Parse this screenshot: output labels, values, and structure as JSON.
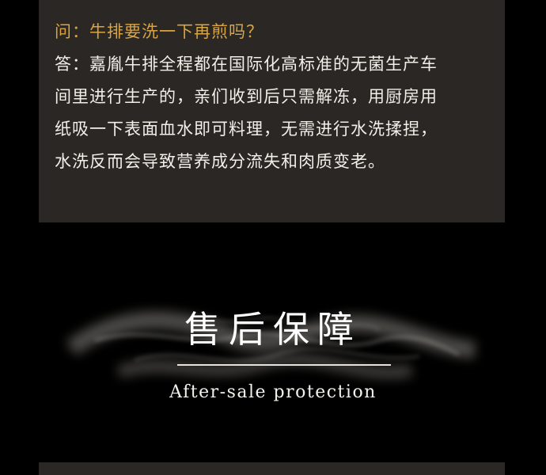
{
  "faq": {
    "question": "问：牛排要洗一下再煎吗？",
    "answer_lines": [
      "答：嘉胤牛排全程都在国际化高标准的无菌生产车",
      "间里进行生产的，亲们收到后只需解冻，用厨房用",
      "纸吸一下表面血水即可料理，无需进行水洗揉捏，",
      "水洗反而会导致营养成分流失和肉质变老。"
    ]
  },
  "section": {
    "title": "售后保障",
    "subtitle": "After-sale protection"
  },
  "colors": {
    "page_background": "#000000",
    "card_background": "#2a2724",
    "question_gold": "#d9a441",
    "answer_text": "#f2efe9",
    "title_white": "#ffffff"
  }
}
